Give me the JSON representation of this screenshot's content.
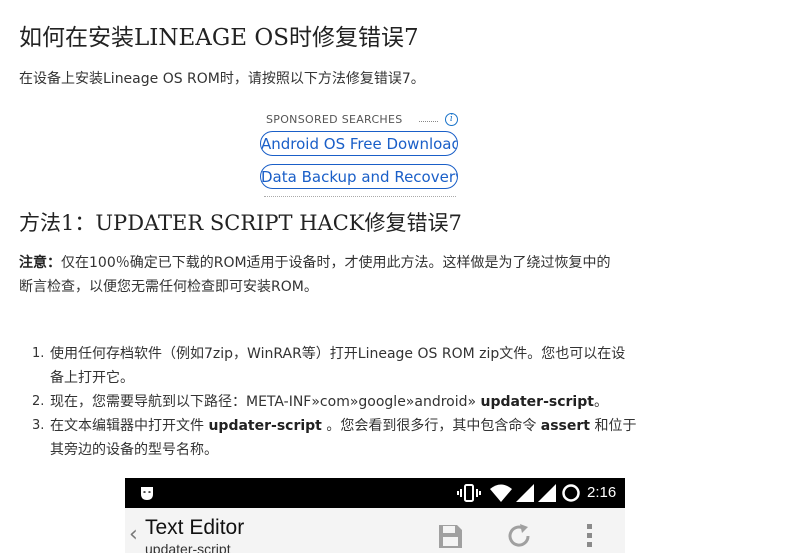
{
  "article": {
    "title": "如何在安装LINEAGE OS时修复错误7",
    "intro": "在设备上安装Lineage OS ROM时，请按照以下方法修复错误7。"
  },
  "sponsored": {
    "label": "SPONSORED SEARCHES",
    "info": "i",
    "links": [
      "Android OS Free Downloads",
      "Data Backup and Recovery"
    ]
  },
  "method1": {
    "title": "方法1：UPDATER SCRIPT HACK修复错误7",
    "note_label": "注意：",
    "note_line1": "仅在100％确定已下载的ROM适用于设备时，才使用此方法。这样做是为了绕过恢复中的",
    "note_line2": "断言检查，以便您无需任何检查即可安装ROM。"
  },
  "steps": [
    {
      "num": "1.",
      "line1": "使用任何存档软件（例如7zip，WinRAR等）打开Lineage OS ROM zip文件。您也可以在设",
      "line2": "备上打开它。"
    },
    {
      "num": "2.",
      "text": "现在，您需要导航到以下路径：META-INF»com»google»android» ",
      "bold": "updater-script",
      "end": "。"
    },
    {
      "num": "3.",
      "pre": "在文本编辑器中打开文件 ",
      "bold1": "updater-script",
      "mid": " 。您会看到很多行，其中包含命令 ",
      "bold2": "assert",
      "post": " 和位于",
      "line2": "其旁边的设备的型号名称。"
    }
  ],
  "phone": {
    "clock": "2:16",
    "back": "‹",
    "app_title": "Text Editor",
    "app_subtitle": "updater-script",
    "icons": [
      "incognito-mask-icon",
      "vibrate-icon",
      "wifi-icon",
      "signal-icon",
      "signal-icon",
      "sync-icon",
      "back-chevron-icon",
      "save-icon",
      "refresh-icon",
      "more-vert-icon"
    ],
    "colors": {
      "statusbar": "#000000",
      "appbar": "#f4f4f4",
      "toolbar_icon": "#9a9a9a"
    }
  },
  "colors": {
    "link": "#1a5fc8",
    "text": "#333333",
    "heading": "#222222"
  }
}
